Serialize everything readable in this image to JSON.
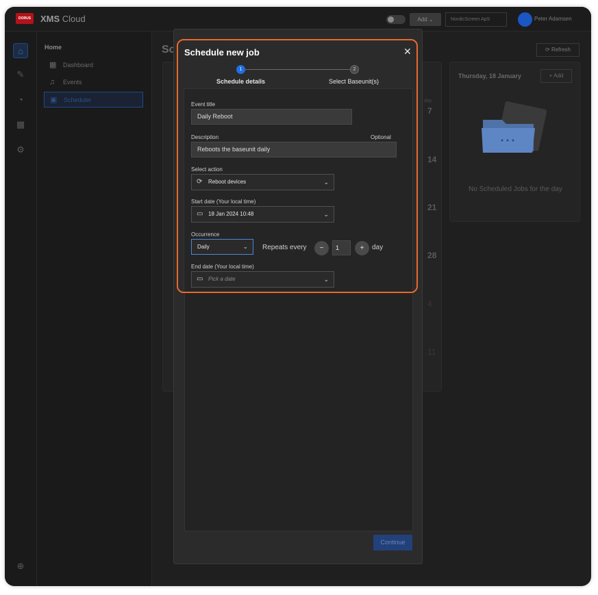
{
  "app": {
    "logo_text": "DORUS",
    "name_bold": "XMS",
    "name_rest": " Cloud",
    "add_button": "Add ⌄",
    "org": "NordicScreen ApS",
    "user": "Peter Adamsen"
  },
  "nav": {
    "home": "Home",
    "items": [
      {
        "label": "Dashboard",
        "icon": "grid-icon"
      },
      {
        "label": "Events",
        "icon": "bell-icon"
      },
      {
        "label": "Scheduler",
        "icon": "calendar-icon"
      }
    ]
  },
  "background": {
    "title": "Sc",
    "refresh": "⟳ Refresh",
    "day_header": "day",
    "week_numbers": [
      "7",
      "14",
      "21",
      "28",
      "4",
      "11"
    ],
    "right_card": {
      "date": "Thursday, 18 January",
      "add": "+ Add",
      "empty": "No Scheduled Jobs for the day"
    }
  },
  "modal": {
    "title": "Schedule new job",
    "steps": [
      {
        "number": "1",
        "label": "Schedule details"
      },
      {
        "number": "2",
        "label": "Select Baseunit(s)"
      }
    ],
    "fields": {
      "event_title_label": "Event title",
      "event_title_value": "Daily Reboot",
      "description_label": "Description",
      "optional": "Optional",
      "description_value": "Reboots the baseunit daily",
      "select_action_label": "Select action",
      "select_action_value": "Reboot devices",
      "start_date_label": "Start date (Your local time)",
      "start_date_value": "18 Jan 2024 10:48",
      "occurrence_label": "Occurrence",
      "occurrence_value": "Daily",
      "repeats_label": "Repeats every",
      "repeats_value": "1",
      "repeats_unit": "day",
      "end_date_label": "End date (Your local time)",
      "end_date_placeholder": "Pick a date"
    },
    "continue": "Continue"
  },
  "colors": {
    "accent": "#1f6fe6",
    "highlight": "#e86a2c",
    "logo": "#b3121b"
  }
}
